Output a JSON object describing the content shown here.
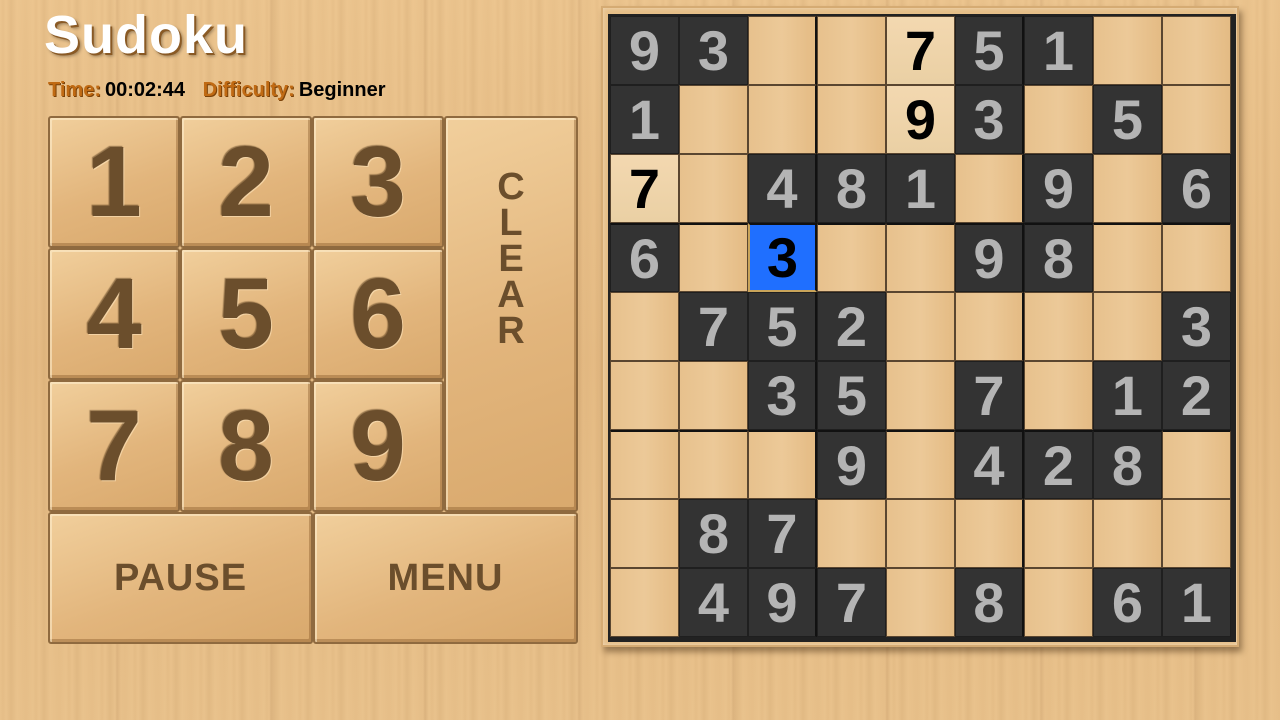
{
  "app": {
    "title": "Sudoku",
    "time_label": "Time:",
    "time_value": "00:02:44",
    "difficulty_label": "Difficulty:",
    "difficulty_value": "Beginner"
  },
  "keypad": {
    "numbers": [
      "1",
      "2",
      "3",
      "4",
      "5",
      "6",
      "7",
      "8",
      "9"
    ],
    "clear_letters": [
      "C",
      "L",
      "E",
      "A",
      "R"
    ],
    "pause_label": "PAUSE",
    "menu_label": "MENU"
  },
  "colors": {
    "given_cell": "#333333",
    "given_digit": "#b4b4b4",
    "selected_cell": "#1f6fff",
    "label_orange": "#c06a13"
  },
  "board": {
    "selected": [
      3,
      2
    ],
    "cells": [
      [
        {
          "v": "9",
          "t": "given"
        },
        {
          "v": "3",
          "t": "given"
        },
        {
          "v": "",
          "t": "empty"
        },
        {
          "v": "",
          "t": "empty"
        },
        {
          "v": "7",
          "t": "user"
        },
        {
          "v": "5",
          "t": "given"
        },
        {
          "v": "1",
          "t": "given"
        },
        {
          "v": "",
          "t": "empty"
        },
        {
          "v": "",
          "t": "empty"
        }
      ],
      [
        {
          "v": "1",
          "t": "given"
        },
        {
          "v": "",
          "t": "empty"
        },
        {
          "v": "",
          "t": "empty"
        },
        {
          "v": "",
          "t": "empty"
        },
        {
          "v": "9",
          "t": "user"
        },
        {
          "v": "3",
          "t": "given"
        },
        {
          "v": "",
          "t": "empty"
        },
        {
          "v": "5",
          "t": "given"
        },
        {
          "v": "",
          "t": "empty"
        }
      ],
      [
        {
          "v": "7",
          "t": "user"
        },
        {
          "v": "",
          "t": "empty"
        },
        {
          "v": "4",
          "t": "given"
        },
        {
          "v": "8",
          "t": "given"
        },
        {
          "v": "1",
          "t": "given"
        },
        {
          "v": "",
          "t": "empty"
        },
        {
          "v": "9",
          "t": "given"
        },
        {
          "v": "",
          "t": "empty"
        },
        {
          "v": "6",
          "t": "given"
        }
      ],
      [
        {
          "v": "6",
          "t": "given"
        },
        {
          "v": "",
          "t": "empty"
        },
        {
          "v": "3",
          "t": "selected"
        },
        {
          "v": "",
          "t": "empty"
        },
        {
          "v": "",
          "t": "empty"
        },
        {
          "v": "9",
          "t": "given"
        },
        {
          "v": "8",
          "t": "given"
        },
        {
          "v": "",
          "t": "empty"
        },
        {
          "v": "",
          "t": "empty"
        }
      ],
      [
        {
          "v": "",
          "t": "empty"
        },
        {
          "v": "7",
          "t": "given"
        },
        {
          "v": "5",
          "t": "given"
        },
        {
          "v": "2",
          "t": "given"
        },
        {
          "v": "",
          "t": "empty"
        },
        {
          "v": "",
          "t": "empty"
        },
        {
          "v": "",
          "t": "empty"
        },
        {
          "v": "",
          "t": "empty"
        },
        {
          "v": "3",
          "t": "given"
        }
      ],
      [
        {
          "v": "",
          "t": "empty"
        },
        {
          "v": "",
          "t": "empty"
        },
        {
          "v": "3",
          "t": "given"
        },
        {
          "v": "5",
          "t": "given"
        },
        {
          "v": "",
          "t": "empty"
        },
        {
          "v": "7",
          "t": "given"
        },
        {
          "v": "",
          "t": "empty"
        },
        {
          "v": "1",
          "t": "given"
        },
        {
          "v": "2",
          "t": "given"
        }
      ],
      [
        {
          "v": "",
          "t": "empty"
        },
        {
          "v": "",
          "t": "empty"
        },
        {
          "v": "",
          "t": "empty"
        },
        {
          "v": "9",
          "t": "given"
        },
        {
          "v": "",
          "t": "empty"
        },
        {
          "v": "4",
          "t": "given"
        },
        {
          "v": "2",
          "t": "given"
        },
        {
          "v": "8",
          "t": "given"
        },
        {
          "v": "",
          "t": "empty"
        }
      ],
      [
        {
          "v": "",
          "t": "empty"
        },
        {
          "v": "8",
          "t": "given"
        },
        {
          "v": "7",
          "t": "given"
        },
        {
          "v": "",
          "t": "empty"
        },
        {
          "v": "",
          "t": "empty"
        },
        {
          "v": "",
          "t": "empty"
        },
        {
          "v": "",
          "t": "empty"
        },
        {
          "v": "",
          "t": "empty"
        },
        {
          "v": "",
          "t": "empty"
        }
      ],
      [
        {
          "v": "",
          "t": "empty"
        },
        {
          "v": "4",
          "t": "given"
        },
        {
          "v": "9",
          "t": "given"
        },
        {
          "v": "7",
          "t": "given"
        },
        {
          "v": "",
          "t": "empty"
        },
        {
          "v": "8",
          "t": "given"
        },
        {
          "v": "",
          "t": "empty"
        },
        {
          "v": "6",
          "t": "given"
        },
        {
          "v": "1",
          "t": "given"
        }
      ]
    ]
  }
}
